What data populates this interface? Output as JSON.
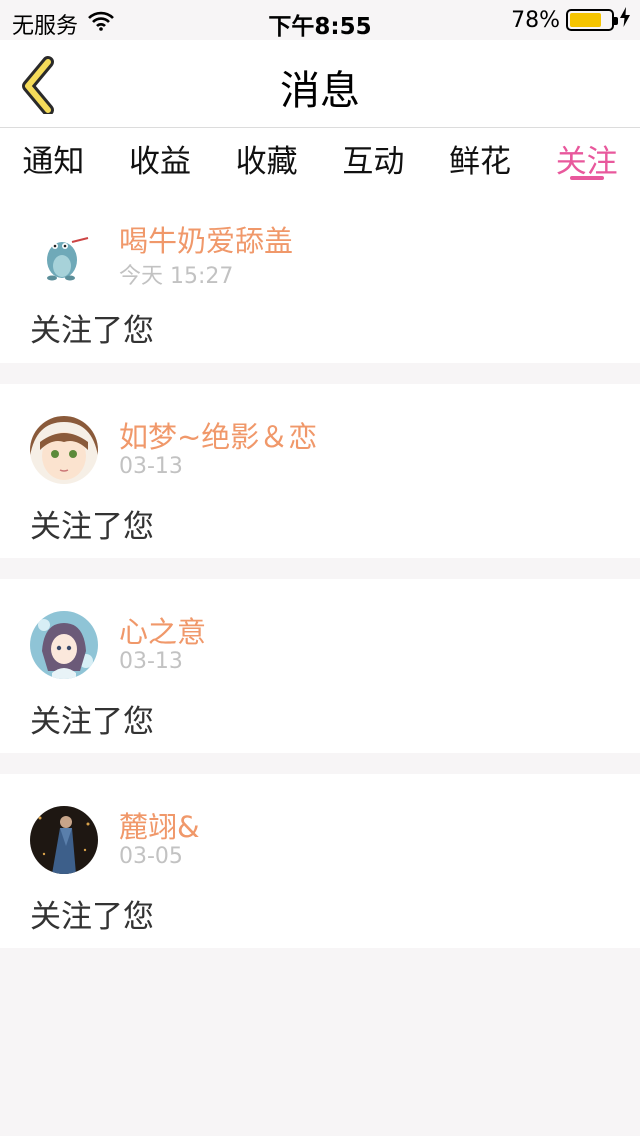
{
  "status": {
    "carrier": "无服务",
    "time": "下午8:55",
    "battery": "78%",
    "battery_level": 0.78
  },
  "nav": {
    "title": "消息"
  },
  "tabs": [
    {
      "label": "通知"
    },
    {
      "label": "收益"
    },
    {
      "label": "收藏"
    },
    {
      "label": "互动"
    },
    {
      "label": "鲜花"
    },
    {
      "label": "关注"
    }
  ],
  "active_tab": "关注",
  "items": [
    {
      "username": "喝牛奶爱舔盖",
      "time": "今天 15:27",
      "message": "关注了您"
    },
    {
      "username": "如梦~绝影＆恋",
      "time": "03-13",
      "message": "关注了您"
    },
    {
      "username": "心之意",
      "time": "03-13",
      "message": "关注了您"
    },
    {
      "username": "麓翊&",
      "time": "03-05",
      "message": "关注了您"
    }
  ],
  "colors": {
    "accent": "#e8589c",
    "username": "#f0986a",
    "back_arrow": "#f5dc5a"
  }
}
